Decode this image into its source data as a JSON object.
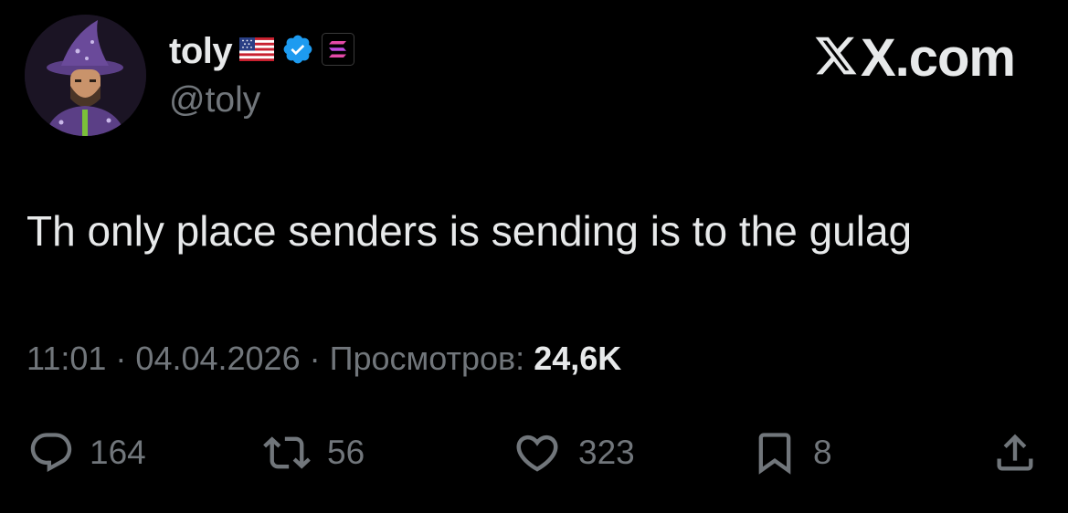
{
  "author": {
    "display_name": "toly",
    "handle": "@toly",
    "verified_color": "#1d9bf0",
    "flag_icon": "us-flag-icon",
    "affiliate_icon": "solana-icon"
  },
  "brand": {
    "label": "X.com"
  },
  "tweet": {
    "text": "Th only place senders is sending is to the gulag",
    "time": "11:01",
    "date": "04.04.2026",
    "separator": "·",
    "views_label": "Просмотров:",
    "views_count": "24,6K"
  },
  "actions": {
    "replies": "164",
    "reposts": "56",
    "likes": "323",
    "bookmarks": "8"
  },
  "colors": {
    "background": "#000000",
    "primary_text": "#e7e9ea",
    "secondary_text": "#71767b",
    "verified": "#1d9bf0"
  }
}
